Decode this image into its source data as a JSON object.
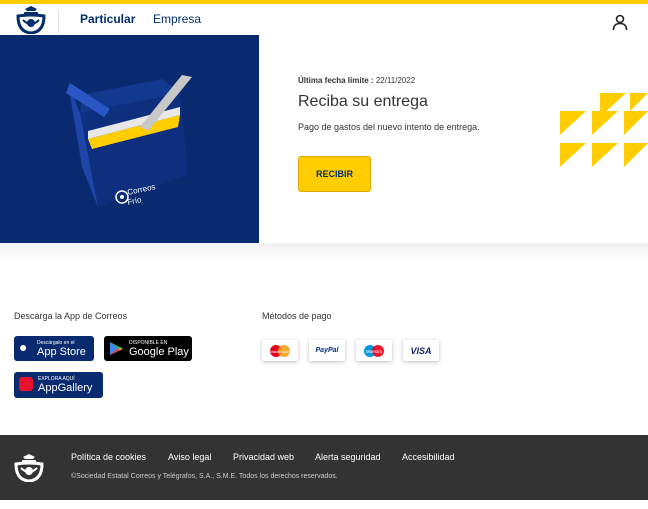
{
  "colors": {
    "brand_yellow": "#ffcd00",
    "brand_blue": "#002e6d",
    "hero_blue": "#0a2a6f",
    "footer_bg": "#333333"
  },
  "header": {
    "logo_icon": "correos-horn-icon",
    "tabs": [
      {
        "label": "Particular",
        "active": true
      },
      {
        "label": "Empresa",
        "active": false
      }
    ],
    "user_icon": "user-icon"
  },
  "hero": {
    "image_brand": "Correos",
    "image_subbrand": "Frío",
    "deadline_label": "Última fecha límite :",
    "deadline_value": "22/11/2022",
    "title": "Reciba su entrega",
    "description": "Pago de gastos del nuevo intento de entrega.",
    "button_label": "RECIBIR"
  },
  "downloads": {
    "title": "Descarga la App de Correos",
    "app_store": {
      "small": "Descárgalo en el",
      "big": "App Store",
      "icon": "apple-icon"
    },
    "google_play": {
      "small": "DISPONIBLE EN",
      "big": "Google Play",
      "icon": "play-icon"
    },
    "app_gallery": {
      "small": "EXPLORA AQUÍ",
      "big": "AppGallery",
      "icon": "huawei-icon"
    }
  },
  "payments": {
    "title": "Métodos de pago",
    "methods": [
      "MasterCard",
      "PayPal",
      "Maestro",
      "VISA"
    ]
  },
  "footer": {
    "links": [
      "Política de cookies",
      "Aviso legal",
      "Privacidad web",
      "Alerta seguridad",
      "Accesibilidad"
    ],
    "copyright": "©Sociedad Estatal Correos y Telégrafos, S.A., S.M.E. Todos los derechos reservados."
  }
}
